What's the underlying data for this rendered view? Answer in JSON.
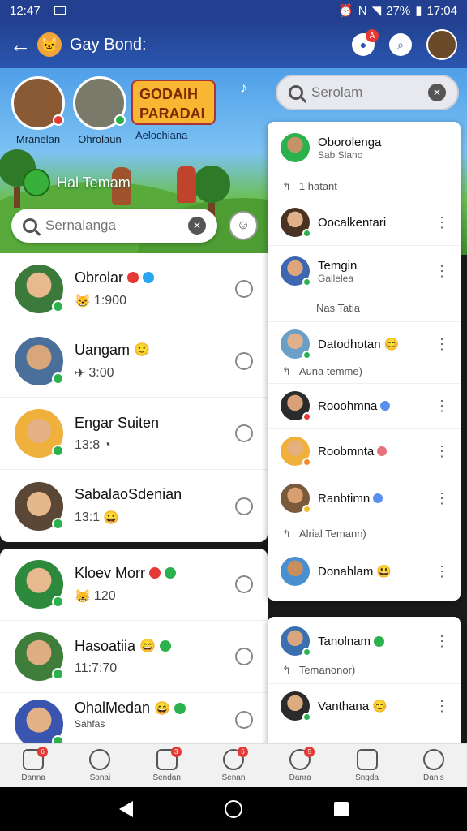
{
  "status_bar": {
    "time_left": "12:47",
    "battery": "27%",
    "time_right": "17:04"
  },
  "header": {
    "title": "Gay Bond:",
    "back_icon": "back-arrow-icon",
    "badge": "A"
  },
  "stories": [
    {
      "name": "Mranelan"
    },
    {
      "name": "Ohrolaun"
    }
  ],
  "banner": {
    "promo": "GODAIH PARADAI",
    "promo_sub": "Aelochiana",
    "friend_tag": "Hal Temam"
  },
  "search_main": {
    "placeholder": "Sernalanga"
  },
  "search_right": {
    "placeholder": "Serolam"
  },
  "chats": [
    {
      "name": "Obrolar",
      "meta": "1:900",
      "badges": [
        "#e53935",
        "#2aa3f0"
      ],
      "lead": "😸"
    },
    {
      "name": "Uangam",
      "meta": "3:00",
      "badges": [],
      "lead": "✈"
    },
    {
      "name": "Engar Suiten",
      "meta": "13:8",
      "badges": [],
      "lead": ""
    },
    {
      "name": "SabalaoSdenian",
      "meta": "13:1",
      "badges": [],
      "lead": ""
    },
    {
      "name": "Kloev Morr",
      "meta": "120",
      "badges": [
        "#e53935",
        "#2bb24c"
      ],
      "lead": "😸"
    },
    {
      "name": "Hasoatiia",
      "meta": "11:7:70",
      "badges": [
        "#2bb24c"
      ],
      "lead": ""
    },
    {
      "name": "OhalMedan",
      "meta": "Sahfas",
      "badges": [
        "#2bb24c"
      ],
      "lead": ""
    }
  ],
  "right_panel": {
    "top": {
      "name": "Oborolenga",
      "sub": "Sab Slano"
    },
    "note1": "1 hatant",
    "items": [
      {
        "name": "Oocalkentari",
        "sub": ""
      },
      {
        "name": "Temgin",
        "sub": "Gallelea"
      },
      {
        "name": "Datodhotan",
        "sub": ""
      },
      {
        "name": "Rooohmna",
        "sub": ""
      },
      {
        "name": "Roobmnta",
        "sub": ""
      },
      {
        "name": "Ranbtimn",
        "sub": ""
      },
      {
        "name": "Donahlam",
        "sub": ""
      }
    ],
    "note_temgin": "Nas Tatia",
    "note2": "Auna temme)",
    "note3": "Alrial Temann)",
    "bottom_items": [
      {
        "name": "Tanolnam",
        "sub": ""
      },
      {
        "name": "Vanthana",
        "sub": ""
      }
    ],
    "note4": "Temanonor)"
  },
  "bottom_nav": [
    {
      "label": "Danna",
      "badge": "6"
    },
    {
      "label": "Sonai",
      "badge": ""
    },
    {
      "label": "Sendan",
      "badge": "3"
    },
    {
      "label": "Senan",
      "badge": "6"
    },
    {
      "label": "Danra",
      "badge": "5"
    },
    {
      "label": "Sngda",
      "badge": ""
    },
    {
      "label": "Danis",
      "badge": ""
    }
  ]
}
